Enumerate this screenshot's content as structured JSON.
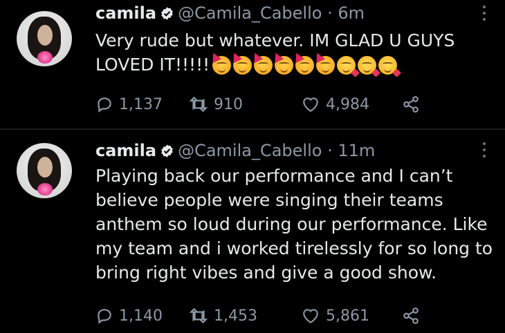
{
  "tweets": [
    {
      "name": "camila",
      "handle": "@Camila_Cabello",
      "time": "· 6m",
      "lines": [
        "Very rude but whatever. IM GLAD U GUYS",
        "LOVED IT!!!!!"
      ],
      "emojis": [
        "party-face",
        "party-face",
        "party-face",
        "party-face",
        "party-face",
        "party-face",
        "smiling-face-with-hearts",
        "smiling-face-with-hearts",
        "smiling-face-with-hearts"
      ],
      "replies": "1,137",
      "retweets": "910",
      "likes": "4,984"
    },
    {
      "name": "camila",
      "handle": "@Camila_Cabello",
      "time": "· 11m",
      "lines": [
        "Playing back our performance and I can’t",
        "believe people were singing their teams",
        "anthem so loud during our performance. Like",
        "my team and i worked tirelessly for so long to",
        "bring right vibes and give a good show."
      ],
      "replies": "1,140",
      "retweets": "1,453",
      "likes": "5,861"
    }
  ],
  "colors": {
    "background": "#000000",
    "text": "#e7e9ea",
    "muted": "#8b98a5",
    "verified": "#1d9bf0"
  }
}
